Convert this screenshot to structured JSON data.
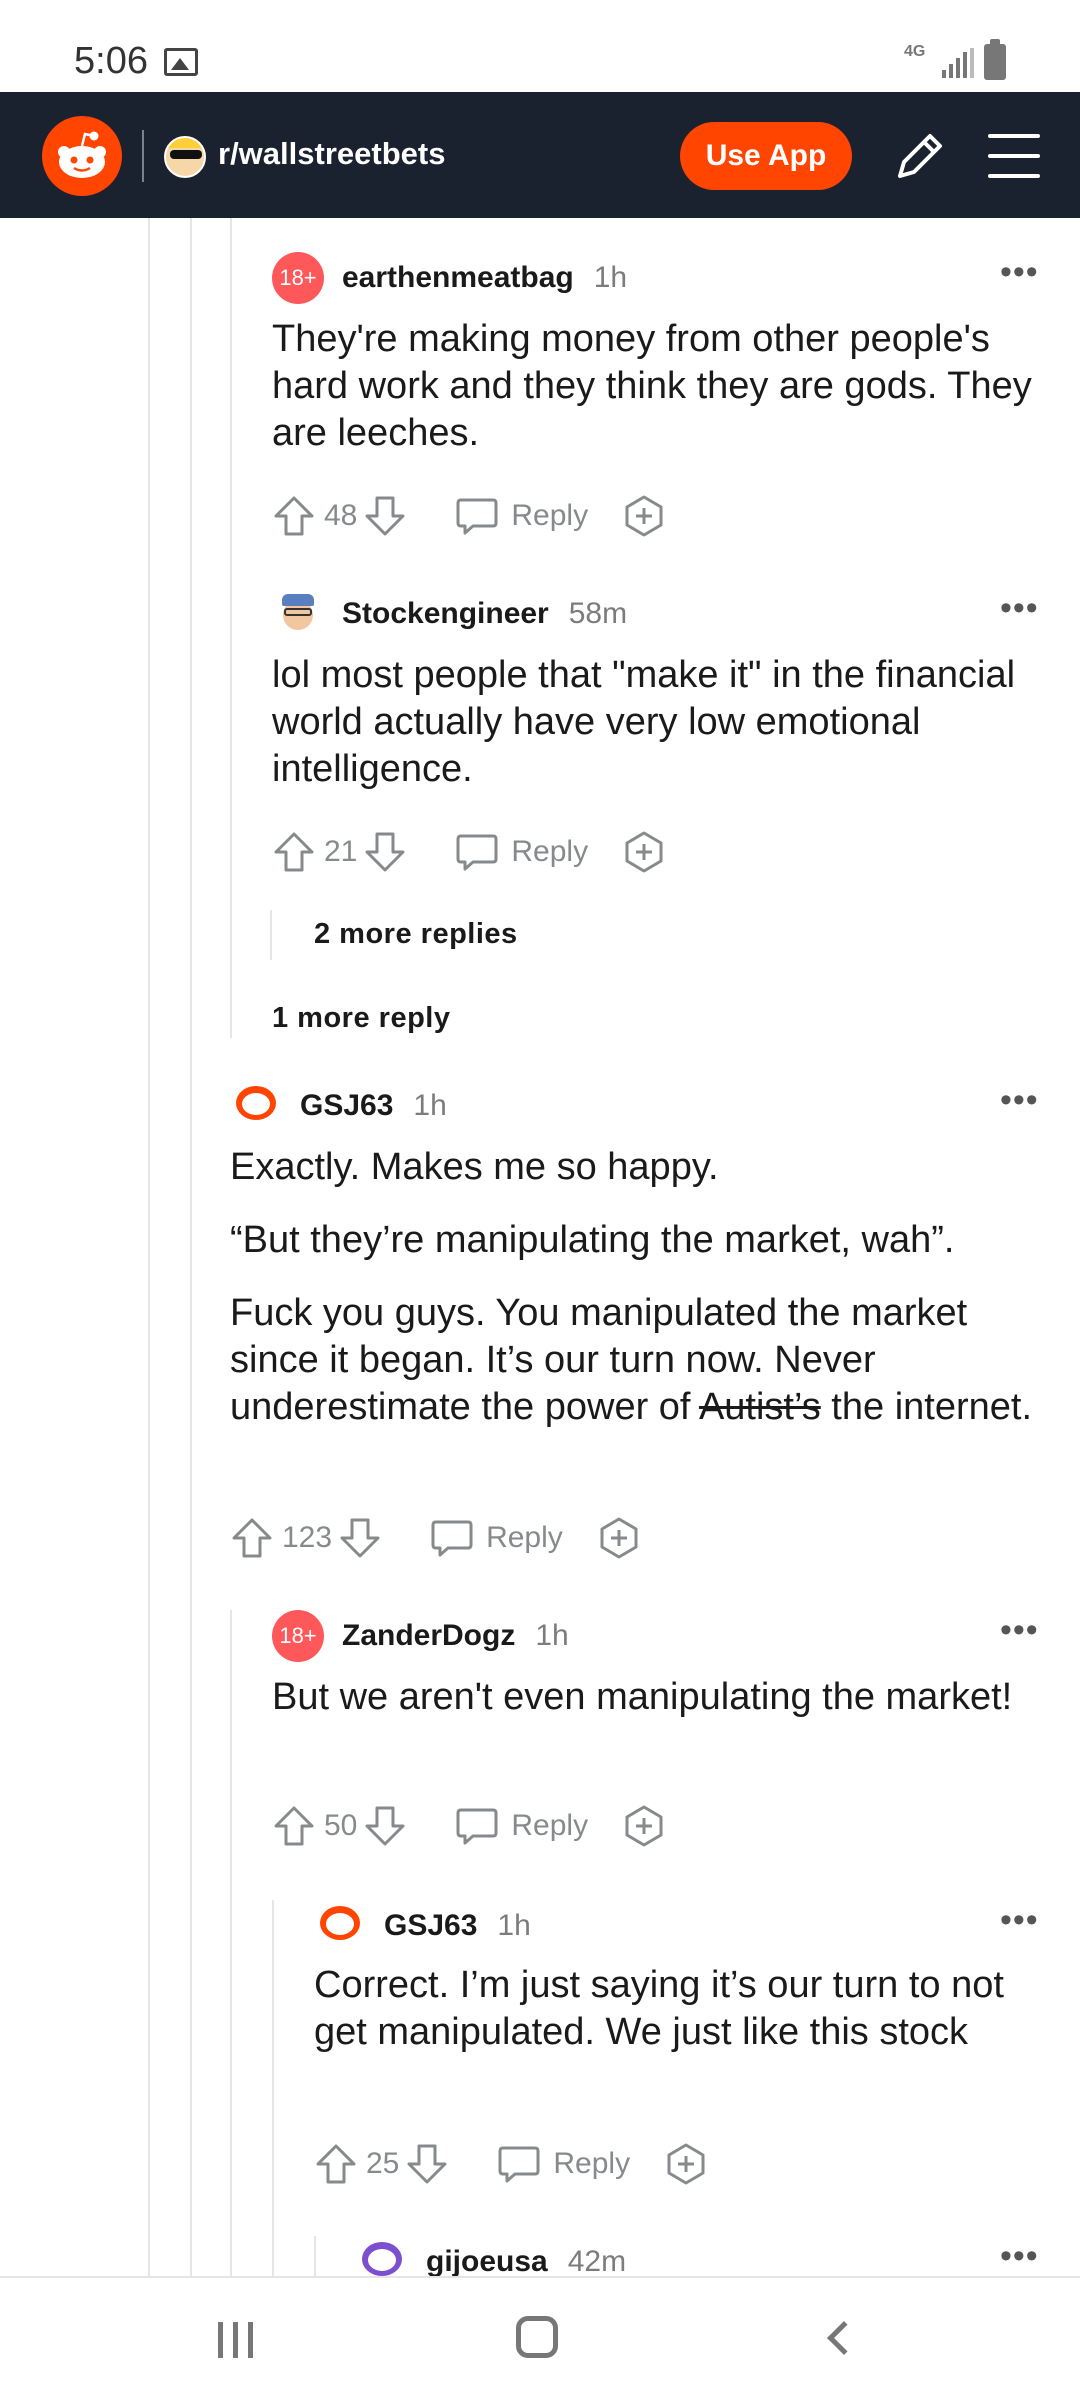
{
  "status_bar": {
    "time": "5:06",
    "network": "4G",
    "icons": [
      "image-icon",
      "signal-icon",
      "battery-icon"
    ]
  },
  "header": {
    "subreddit": "r/wallstreetbets",
    "use_app_label": "Use App",
    "icons": [
      "reddit-logo-icon",
      "pencil-icon",
      "menu-icon"
    ]
  },
  "colors": {
    "brand": "#ff4500",
    "header_bg": "#1a2230",
    "nsfw": "#ff585b",
    "meta_gray": "#7c7c7c"
  },
  "comments": [
    {
      "avatar": "18+",
      "username": "earthenmeatbag",
      "age": "1h",
      "body": [
        "They're making money from other people's hard work and they think they are gods. They are leeches."
      ],
      "votes": "48",
      "reply_label": "Reply"
    },
    {
      "username": "Stockengineer",
      "age": "58m",
      "body": [
        "lol most people that \"make it\" in the financial world actually have very low emotional intelligence."
      ],
      "votes": "21",
      "reply_label": "Reply"
    },
    {
      "username": "GSJ63",
      "age": "1h",
      "body": [
        "Exactly. Makes me so happy.",
        "“But they’re manipulating the market, wah”."
      ],
      "body_p3_before": "Fuck you guys. You manipulated the market since it began. It’s our turn now. Never underestimate the power of ",
      "body_p3_strike": "Autist’s",
      "body_p3_after": " the internet.",
      "votes": "123",
      "reply_label": "Reply"
    },
    {
      "avatar": "18+",
      "username": "ZanderDogz",
      "age": "1h",
      "body": [
        "But we aren't even manipulating the market!"
      ],
      "votes": "50",
      "reply_label": "Reply"
    },
    {
      "username": "GSJ63",
      "age": "1h",
      "body": [
        "Correct. I’m just saying it’s our turn to not get manipulated. We just like this stock"
      ],
      "votes": "25",
      "reply_label": "Reply"
    },
    {
      "username": "gijoeusa",
      "age": "42m"
    }
  ],
  "more_replies": {
    "a": "2 more replies",
    "b": "1 more reply"
  },
  "menu_dots": "•••",
  "nav": {
    "icons": [
      "recent-apps-icon",
      "home-icon",
      "back-icon"
    ]
  }
}
